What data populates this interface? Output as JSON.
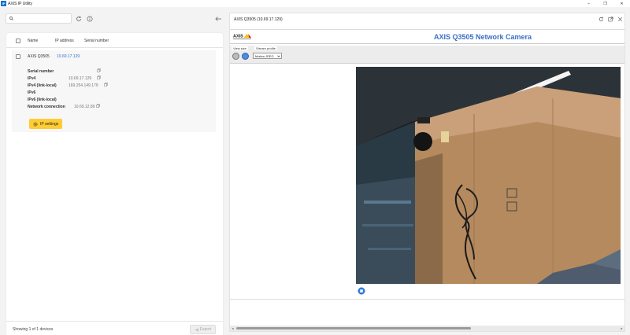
{
  "app": {
    "logo_text": "IP",
    "title": "AXIS IP Utility",
    "window_controls": [
      "–",
      "❐",
      "✕"
    ]
  },
  "search": {
    "placeholder": "",
    "value": ""
  },
  "table": {
    "headers": {
      "name": "Name",
      "ip": "IP address",
      "serial": "Serial number"
    }
  },
  "device": {
    "name": "AXIS Q3505",
    "ip": "10.69.17.129",
    "details": [
      {
        "label": "Serial number",
        "value": ""
      },
      {
        "label": "IPv4",
        "value": "10.69.17.129"
      },
      {
        "label": "IPv4 (link-local)",
        "value": "169.254.149.179"
      },
      {
        "label": "IPv6",
        "value": ""
      },
      {
        "label": "IPv6 (link-local)",
        "value": ""
      },
      {
        "label": "Network connection",
        "value": "10.69.12.89"
      }
    ],
    "ip_settings_label": "IP settings"
  },
  "status": {
    "showing": "Showing 1 of 1 devices",
    "export_label": "Export"
  },
  "preview": {
    "title": "AXIS Q3505 (10.69.17.129)",
    "camera_title": "AXIS Q3505 Network Camera",
    "logo_text": "AXIS",
    "view_size_label": "View size",
    "stream_profile_label": "Stream profile",
    "stream_profile_value": "Motion JPEG"
  },
  "colors": {
    "accent_yellow": "#ffcc33",
    "link_blue": "#2f6fd0",
    "camera_title_blue": "#3a6fc4"
  }
}
